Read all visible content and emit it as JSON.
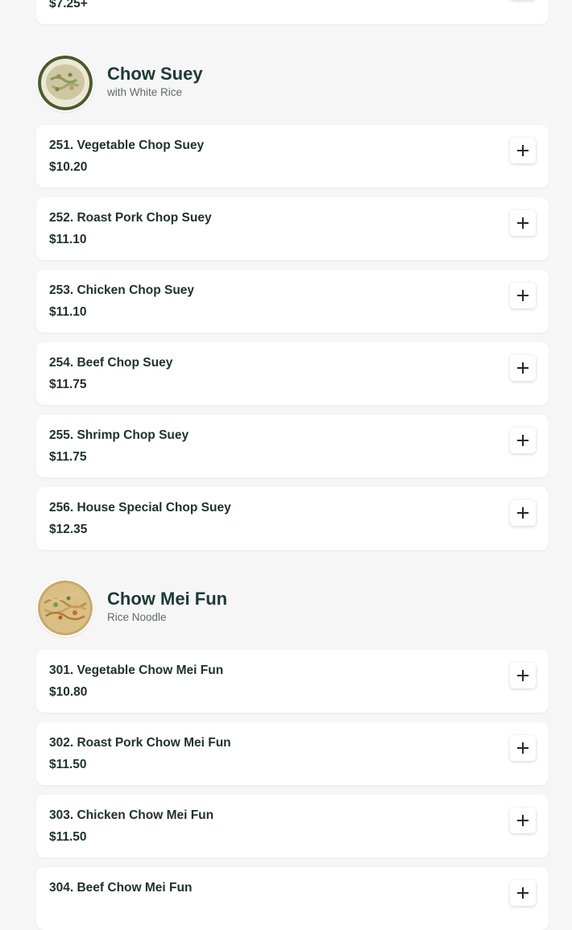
{
  "top_partial_item": {
    "price": "$7.25+"
  },
  "sections": [
    {
      "title": "Chow Suey",
      "subtitle": "with White Rice",
      "thumbnail_icon": "chop-suey-dish-photo",
      "items": [
        {
          "name": "251. Vegetable Chop Suey",
          "price": "$10.20"
        },
        {
          "name": "252. Roast Pork Chop Suey",
          "price": "$11.10"
        },
        {
          "name": "253. Chicken Chop Suey",
          "price": "$11.10"
        },
        {
          "name": "254. Beef Chop Suey",
          "price": "$11.75"
        },
        {
          "name": "255. Shrimp Chop Suey",
          "price": "$11.75"
        },
        {
          "name": "256. House Special Chop Suey",
          "price": "$12.35"
        }
      ]
    },
    {
      "title": "Chow Mei Fun",
      "subtitle": "Rice Noodle",
      "thumbnail_icon": "mei-fun-dish-photo",
      "items": [
        {
          "name": "301. Vegetable Chow Mei Fun",
          "price": "$10.80"
        },
        {
          "name": "302. Roast Pork Chow Mei Fun",
          "price": "$11.50"
        },
        {
          "name": "303. Chicken Chow Mei Fun",
          "price": "$11.50"
        },
        {
          "name": "304. Beef Chow Mei Fun",
          "price": ""
        }
      ]
    }
  ],
  "add_button_icon": "plus-icon",
  "colors": {
    "background": "#f6f6f6",
    "card": "#ffffff",
    "text": "#213130",
    "heading": "#1d3a37",
    "subtext": "#5f6b6a"
  }
}
